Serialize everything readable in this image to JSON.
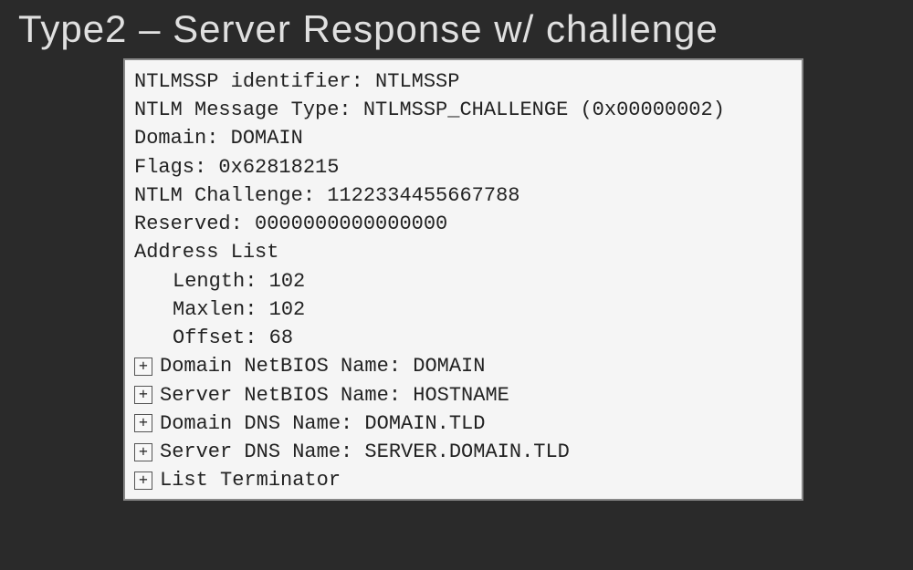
{
  "title": "Type2 – Server Response w/ challenge",
  "packet": {
    "identifier": "NTLMSSP identifier: NTLMSSP",
    "msgtype": "NTLM Message Type: NTLMSSP_CHALLENGE (0x00000002)",
    "domain": "Domain: DOMAIN",
    "flags": "Flags: 0x62818215",
    "challenge": "NTLM Challenge: 1122334455667788",
    "reserved": "Reserved: 0000000000000000",
    "addrlist": "Address List",
    "length": "Length: 102",
    "maxlen": "Maxlen: 102",
    "offset": "Offset: 68",
    "dom_netbios": "Domain NetBIOS Name: DOMAIN",
    "srv_netbios": "Server NetBIOS Name: HOSTNAME",
    "dom_dns": "Domain DNS Name: DOMAIN.TLD",
    "srv_dns": "Server DNS Name: SERVER.DOMAIN.TLD",
    "terminator": "List Terminator"
  },
  "expand_glyph": "+"
}
